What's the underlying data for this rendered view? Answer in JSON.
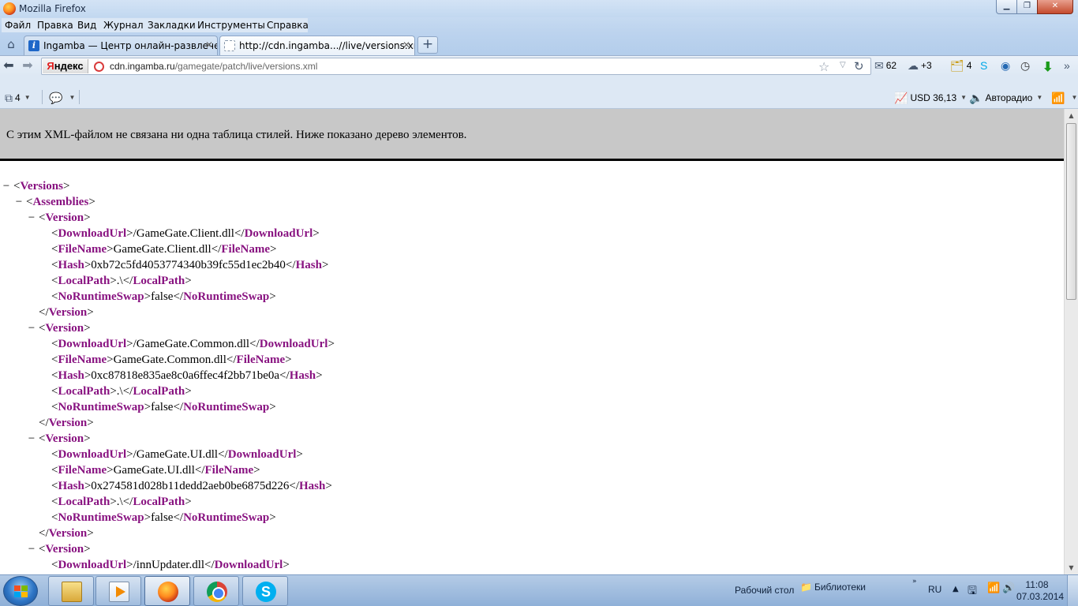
{
  "window": {
    "title": "Mozilla Firefox",
    "minimize_glyph": "▁",
    "maximize_glyph": "❐",
    "close_glyph": "✕"
  },
  "menu": [
    "Файл",
    "Правка",
    "Вид",
    "Журнал",
    "Закладки",
    "Инструменты",
    "Справка"
  ],
  "tabs": [
    {
      "label": "Ingamba — Центр онлайн-развлече...",
      "favicon_glyph": "i",
      "close": "✕",
      "active": false
    },
    {
      "label": "http://cdn.ingamba...//live/versions.xml",
      "close": "✕",
      "active": true
    }
  ],
  "newtab_glyph": "+",
  "nav": {
    "back_glyph": "⬅",
    "forward_glyph": "➡",
    "home_glyph": "⌂",
    "search_logo_first": "Я",
    "search_logo_rest": "ндекс",
    "url_host": "cdn.ingamba.ru",
    "url_path": "/gamegate/patch/live/versions.xml",
    "star_glyph": "☆",
    "drop_glyph": "▽",
    "reload_glyph": "↻"
  },
  "toolbar": {
    "mail_glyph": "✉",
    "mail_count": "62",
    "weather_glyph": "☁",
    "weather_temp": "+3",
    "cards_glyph": "🗂",
    "cards_count": "4",
    "skype_glyph": "S",
    "cfg_glyph": "◉",
    "clock_glyph": "◷",
    "download_glyph": "⬇",
    "menu_glyph": "»"
  },
  "addonbar": {
    "share_glyph": "⧉",
    "share_count": "4",
    "comment_glyph": "💬",
    "caret": "▼",
    "usd_glyph": "📈",
    "usd_label": "USD 36,13",
    "radio_glyph": "🔈",
    "radio_label": "Авторадио",
    "signal_glyph": "📶"
  },
  "page": {
    "xml_notice": "С этим XML-файлом не связана ни одна таблица стилей. Ниже показано дерево элементов."
  },
  "xml_tree": {
    "root": "Versions",
    "assemblies": "Assemblies",
    "version": "Version",
    "fields": [
      "DownloadUrl",
      "FileName",
      "Hash",
      "LocalPath",
      "NoRuntimeSwap"
    ],
    "collapse_glyph": "−",
    "versions": [
      {
        "DownloadUrl": "/GameGate.Client.dll",
        "FileName": "GameGate.Client.dll",
        "Hash": "0xb72c5fd4053774340b39fc55d1ec2b40",
        "LocalPath": ".\\",
        "NoRuntimeSwap": "false"
      },
      {
        "DownloadUrl": "/GameGate.Common.dll",
        "FileName": "GameGate.Common.dll",
        "Hash": "0xc87818e835ae8c0a6ffec4f2bb71be0a",
        "LocalPath": ".\\",
        "NoRuntimeSwap": "false"
      },
      {
        "DownloadUrl": "/GameGate.UI.dll",
        "FileName": "GameGate.UI.dll",
        "Hash": "0x274581d028b11dedd2aeb0be6875d226",
        "LocalPath": ".\\",
        "NoRuntimeSwap": "false"
      },
      {
        "DownloadUrl": "/innUpdater.dll"
      }
    ]
  },
  "scrollbar": {
    "up_glyph": "▲",
    "down_glyph": "▼"
  },
  "taskbar": {
    "skype_glyph": "S",
    "desktop_label": "Рабочий стол",
    "libraries_glyph": "📁",
    "libraries_label": "Библиотеки",
    "tray_chevron": "»",
    "lang": "RU",
    "tray_up_glyph": "▲",
    "tray_device_glyph": "🖫",
    "tray_net_glyph": "📶",
    "tray_vol_glyph": "🔊",
    "time": "11:08",
    "date": "07.03.2014"
  }
}
